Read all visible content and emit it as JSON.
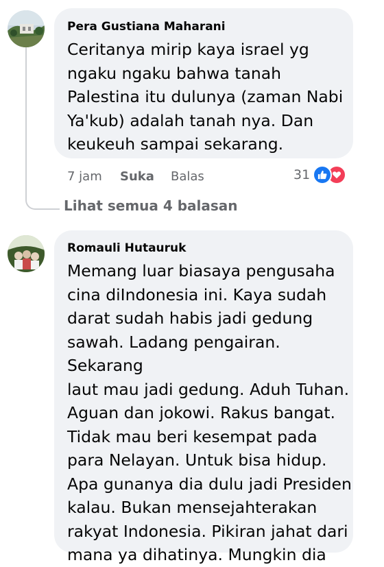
{
  "comments": [
    {
      "author": "Pera Gustiana Maharani",
      "text": "Ceritanya mirip kaya israel yg\nngaku ngaku bahwa tanah\nPalestina itu dulunya (zaman Nabi\nYa'kub) adalah tanah nya. Dan\nkeukeuh sampai sekarang.",
      "time": "7 jam",
      "like_label": "Suka",
      "reply_label": "Balas",
      "reaction_count": "31",
      "reaction_icons": [
        "like-icon",
        "love-icon"
      ]
    },
    {
      "author": "Romauli Hutauruk",
      "text": "Memang luar biasaya pengusaha\ncina diIndonesia ini. Kaya sudah\ndarat sudah habis jadi gedung\nsawah. Ladang pengairan. Sekarang\nlaut mau jadi gedung. Aduh Tuhan.\nAguan dan jokowi. Rakus bangat.\nTidak mau beri kesempat pada\npara Nelayan. Untuk bisa hidup.\nApa gunanya dia dulu jadi Presiden\nkalau. Bukan mensejahterakan\nrakyat Indonesia. Pikiran jahat dari\nmana ya dihatinya. Mungkin dia"
    }
  ],
  "view_replies_label": "Lihat semua 4 balasan",
  "colors": {
    "bubble": "#f0f2f5",
    "text": "#050505",
    "secondary": "#65676b",
    "like_blue": "#1877f2",
    "love_red": "#f33e58"
  }
}
